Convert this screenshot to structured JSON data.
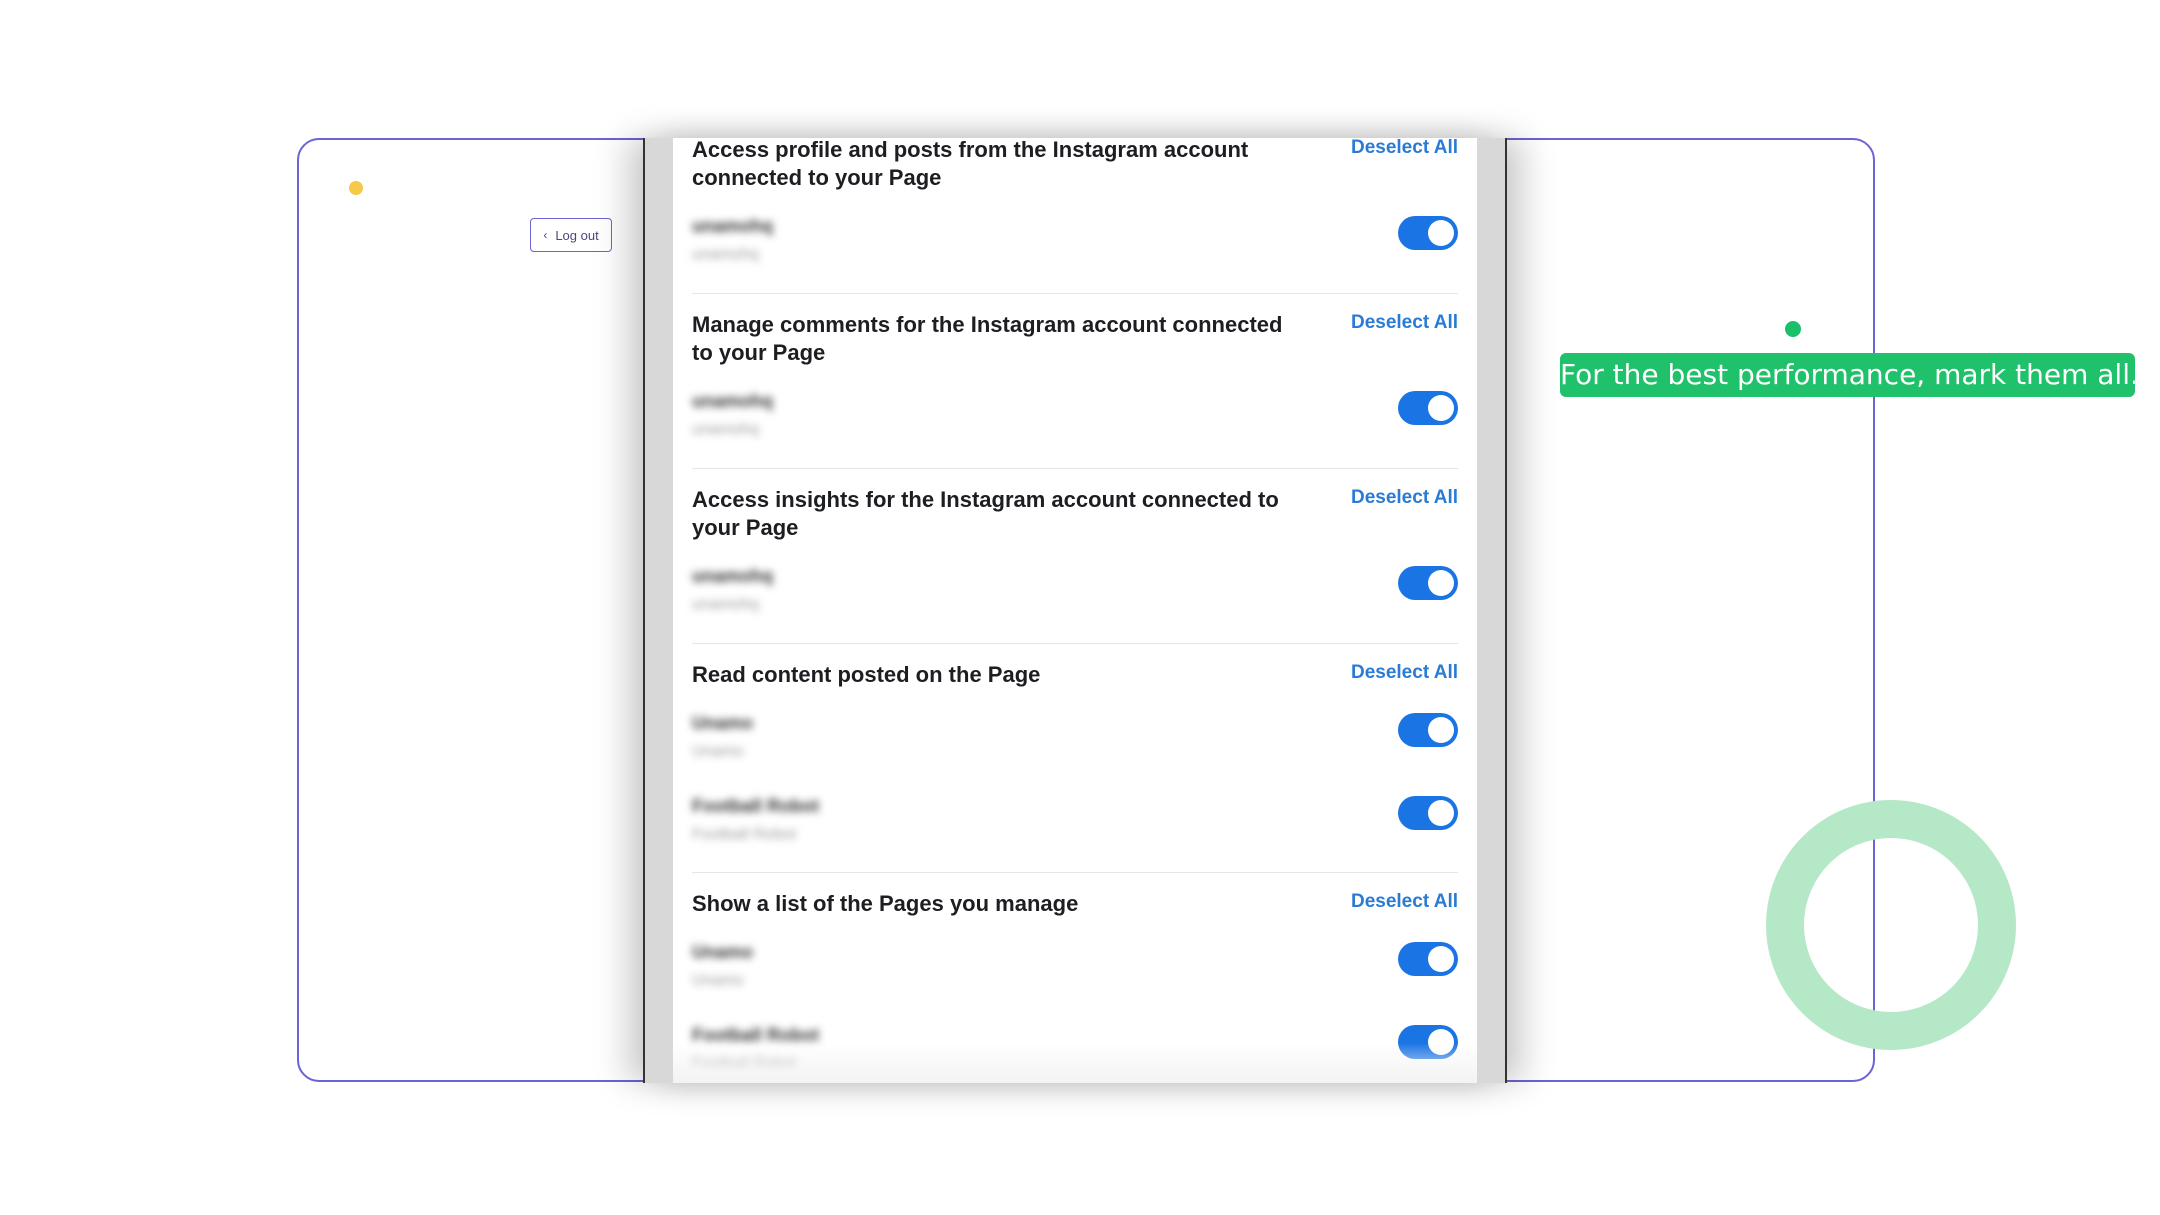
{
  "left_panel": {
    "logout_label": "Log out"
  },
  "callout": {
    "text": "For the best performance, mark them all."
  },
  "accent_colors": {
    "frame_border": "#6b63d6",
    "toggle_on": "#1b74e4",
    "callout_bg": "#1fc16b",
    "ring": "#b5e8c6",
    "yellow_dot": "#f7c948"
  },
  "permissions": {
    "sections": [
      {
        "title": "Access profile and posts from the Instagram account connected to your Page",
        "action": "Deselect All",
        "items": [
          {
            "name": "unamohq",
            "sub": "unamohq",
            "enabled": true
          }
        ]
      },
      {
        "title": "Manage comments for the Instagram account connected to your Page",
        "action": "Deselect All",
        "items": [
          {
            "name": "unamohq",
            "sub": "unamohq",
            "enabled": true
          }
        ]
      },
      {
        "title": "Access insights for the Instagram account connected to your Page",
        "action": "Deselect All",
        "items": [
          {
            "name": "unamohq",
            "sub": "unamohq",
            "enabled": true
          }
        ]
      },
      {
        "title": "Read content posted on the Page",
        "action": "Deselect All",
        "items": [
          {
            "name": "Unamo",
            "sub": "Unamo",
            "enabled": true
          },
          {
            "name": "Football Robot",
            "sub": "Football Robot",
            "enabled": true
          }
        ]
      },
      {
        "title": "Show a list of the Pages you manage",
        "action": "Deselect All",
        "items": [
          {
            "name": "Unamo",
            "sub": "Unamo",
            "enabled": true
          },
          {
            "name": "Football Robot",
            "sub": "Football Robot",
            "enabled": true
          }
        ]
      }
    ]
  }
}
